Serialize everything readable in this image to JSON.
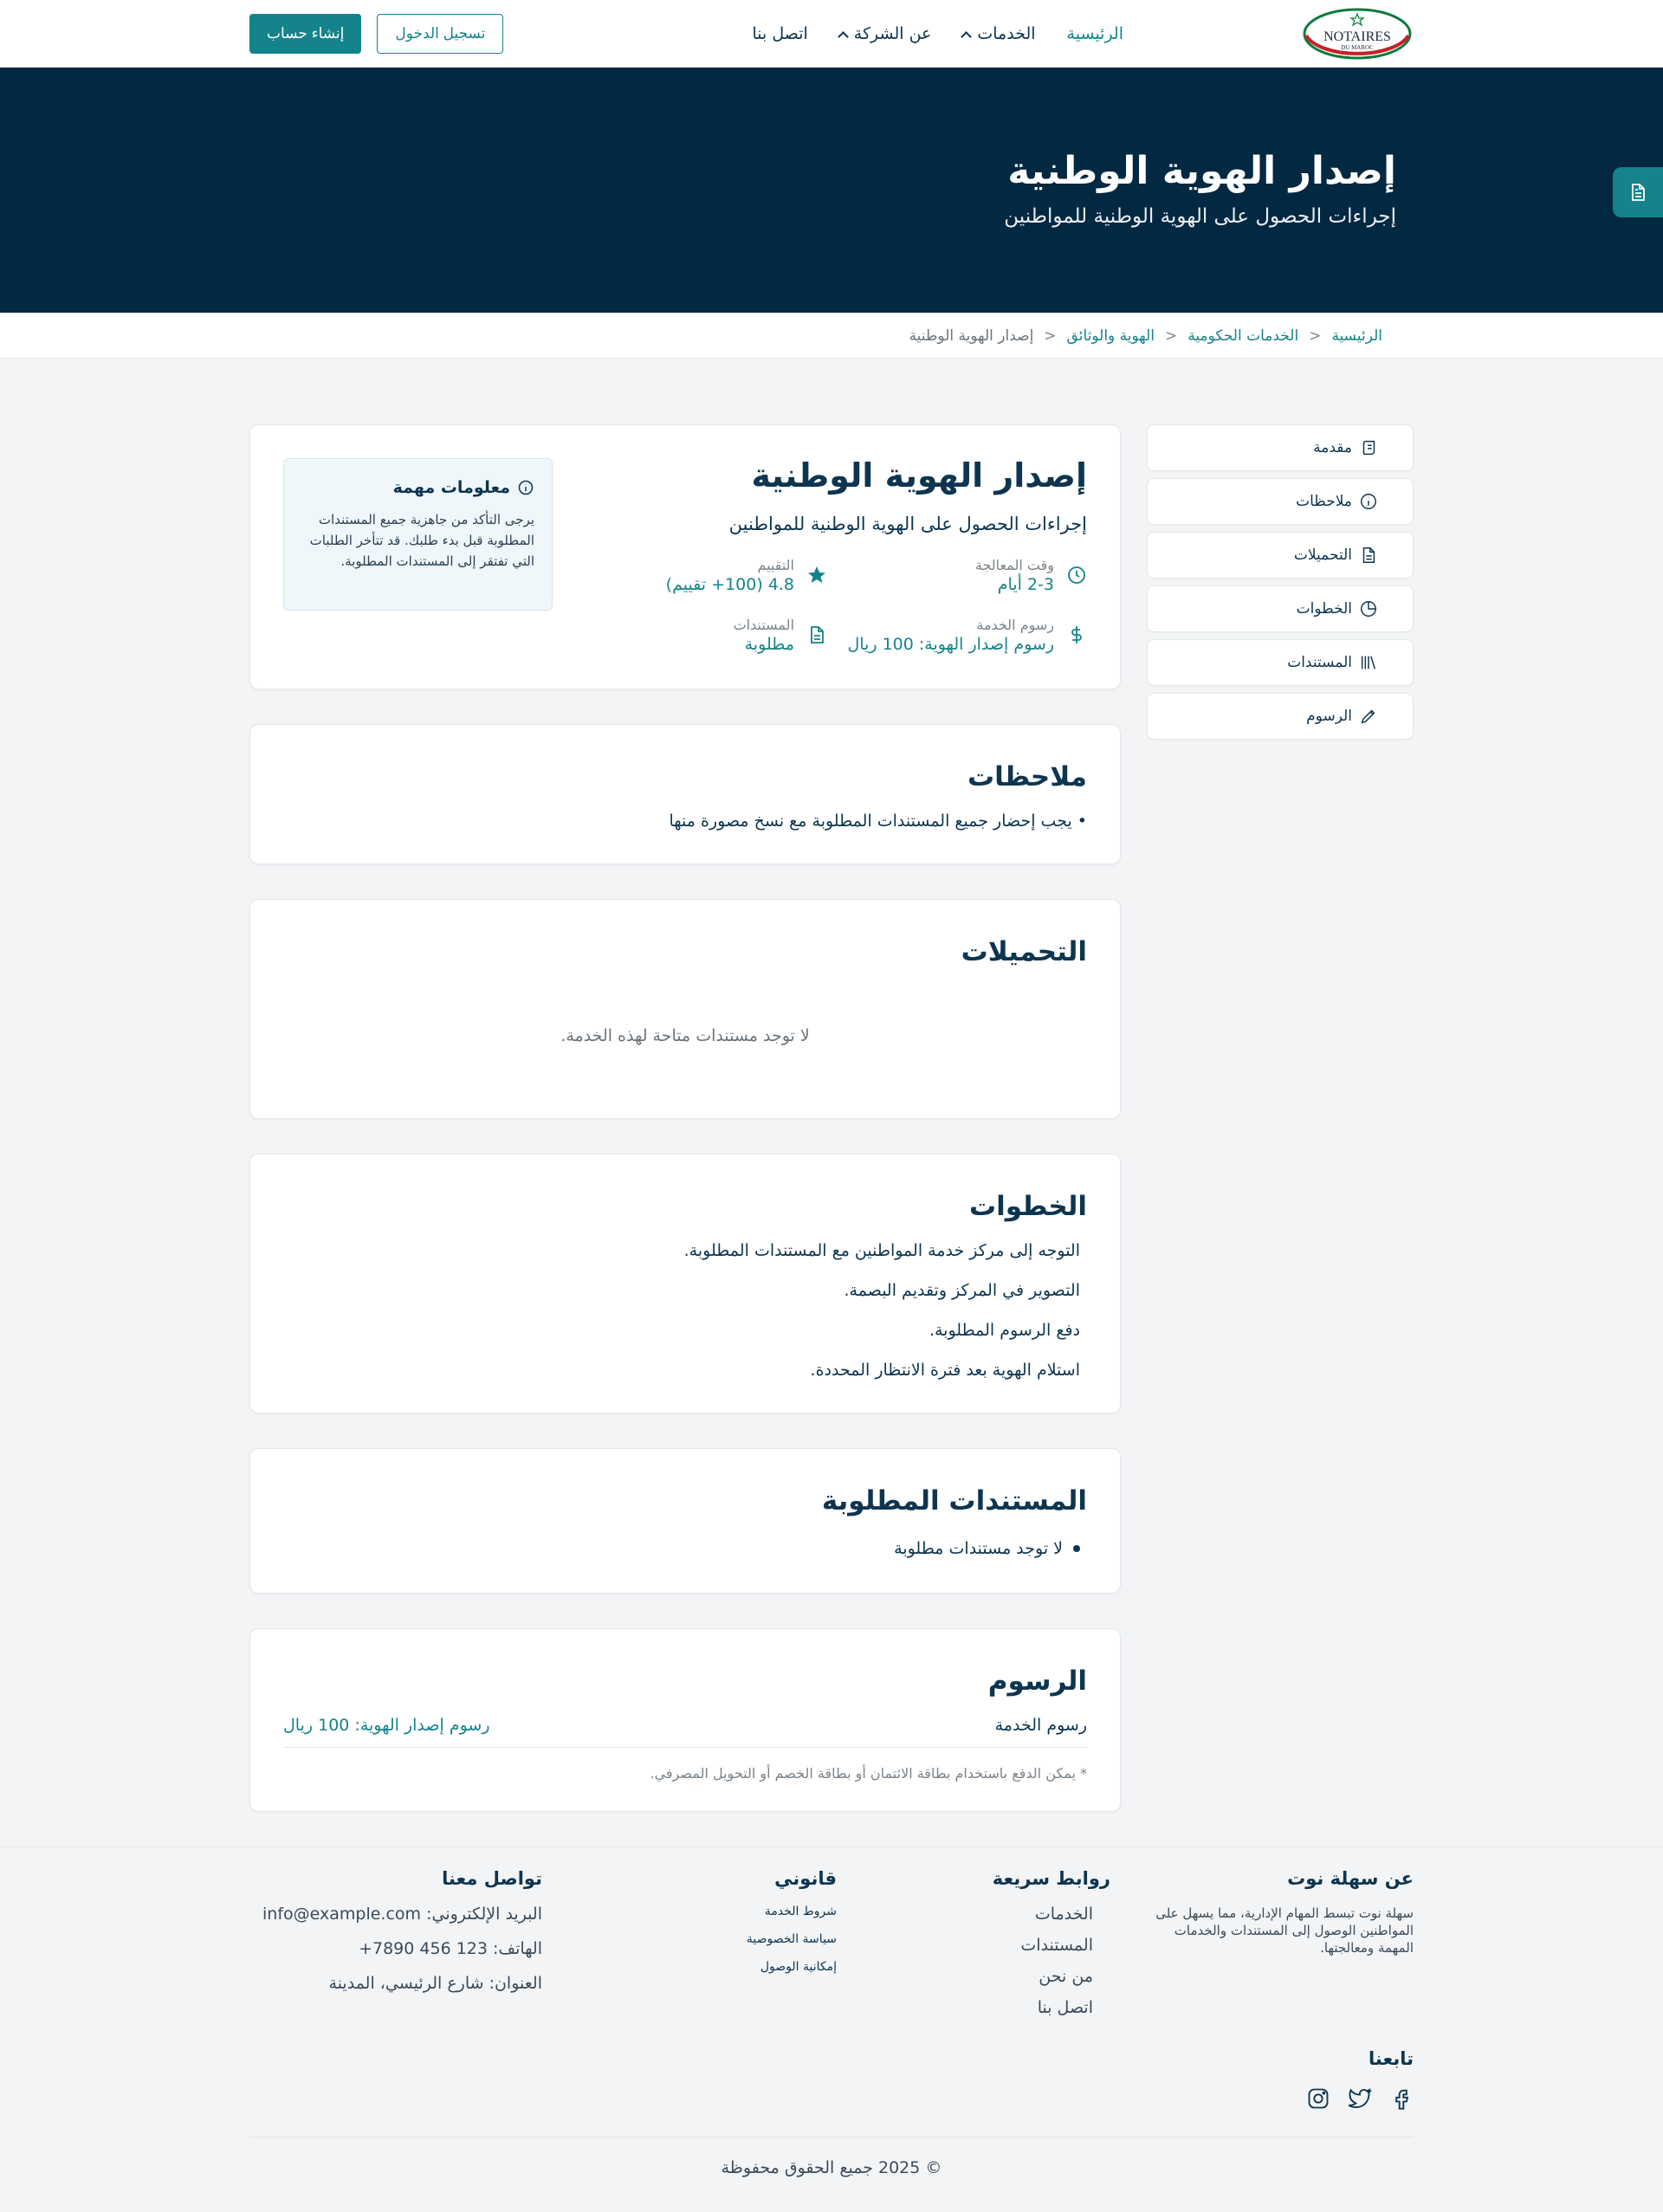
{
  "brand": {
    "logo_text": "NOTAIRES",
    "logo_sub": "DU MAROC"
  },
  "nav": {
    "home": "الرئيسية",
    "services": "الخدمات",
    "company": "عن الشركة",
    "contact": "اتصل بنا"
  },
  "auth": {
    "login": "تسجيل الدخول",
    "register": "إنشاء حساب"
  },
  "hero": {
    "title": "إصدار الهوية الوطنية",
    "subtitle": "إجراءات الحصول على الهوية الوطنية للمواطنين"
  },
  "breadcrumb": [
    "الرئيسية",
    "الخدمات الحكومية",
    "الهوية والوثائق",
    "إصدار الهوية الوطنية"
  ],
  "sidebar": {
    "items": [
      {
        "label": "مقدمة",
        "icon": "scroll-icon"
      },
      {
        "label": "ملاحظات",
        "icon": "info-icon"
      },
      {
        "label": "التحميلات",
        "icon": "file-icon"
      },
      {
        "label": "الخطوات",
        "icon": "pie-chart-icon"
      },
      {
        "label": "المستندات",
        "icon": "library-icon"
      },
      {
        "label": "الرسوم",
        "icon": "pencil-icon"
      }
    ]
  },
  "overview": {
    "title": "إصدار الهوية الوطنية",
    "subtitle": "إجراءات الحصول على الهوية الوطنية للمواطنين",
    "processing_label": "وقت المعالجة",
    "processing_value": "2-3 أيام",
    "rating_label": "التقييم",
    "rating_value": "4.8 (100+ تقييم)",
    "fees_label": "رسوم الخدمة",
    "fees_value": "رسوم إصدار الهوية: 100 ريال",
    "docs_label": "المستندات",
    "docs_value": "مطلوبة"
  },
  "info_box": {
    "title": "معلومات مهمة",
    "text": "يرجى التأكد من جاهزية جميع المستندات المطلوبة قبل بدء طلبك. قد تتأخر الطلبات التي تفتقر إلى المستندات المطلوبة."
  },
  "notes": {
    "title": "ملاحظات",
    "items": [
      "يجب إحضار جميع المستندات المطلوبة مع نسخ مصورة منها"
    ]
  },
  "downloads": {
    "title": "التحميلات",
    "empty": "لا توجد مستندات متاحة لهذه الخدمة."
  },
  "steps": {
    "title": "الخطوات",
    "items": [
      "التوجه إلى مركز خدمة المواطنين مع المستندات المطلوبة.",
      "التصوير في المركز وتقديم البصمة.",
      "دفع الرسوم المطلوبة.",
      "استلام الهوية بعد فترة الانتظار المحددة."
    ]
  },
  "documents": {
    "title": "المستندات المطلوبة",
    "items": [
      "لا توجد مستندات مطلوبة"
    ]
  },
  "fees": {
    "title": "الرسوم",
    "label": "رسوم الخدمة",
    "value": "رسوم إصدار الهوية: 100 ريال",
    "note": "* يمكن الدفع باستخدام بطاقة الائتمان أو بطاقة الخصم أو التحويل المصرفي."
  },
  "footer": {
    "about_title": "عن سهلة نوت",
    "about_text": "سهلة نوت تبسط المهام الإدارية، مما يسهل على المواطنين الوصول إلى المستندات والخدمات المهمة ومعالجتها.",
    "quick_title": "روابط سريعة",
    "quick_links": [
      "الخدمات",
      "المستندات",
      "من نحن",
      "اتصل بنا"
    ],
    "legal_title": "قانوني",
    "legal_links": [
      "شروط الخدمة",
      "سياسة الخصوصية",
      "إمكانية الوصول"
    ],
    "contact_title": "تواصل معنا",
    "email": "البريد الإلكتروني: info@example.com",
    "phone": "الهاتف: 123 456 7890+",
    "address": "العنوان: شارع الرئيسي، المدينة",
    "follow_title": "تابعنا",
    "copyright": "© 2025 جميع الحقوق محفوظة"
  },
  "colors": {
    "primary": "#14838b",
    "navy": "#032841",
    "text": "#0d3550"
  }
}
